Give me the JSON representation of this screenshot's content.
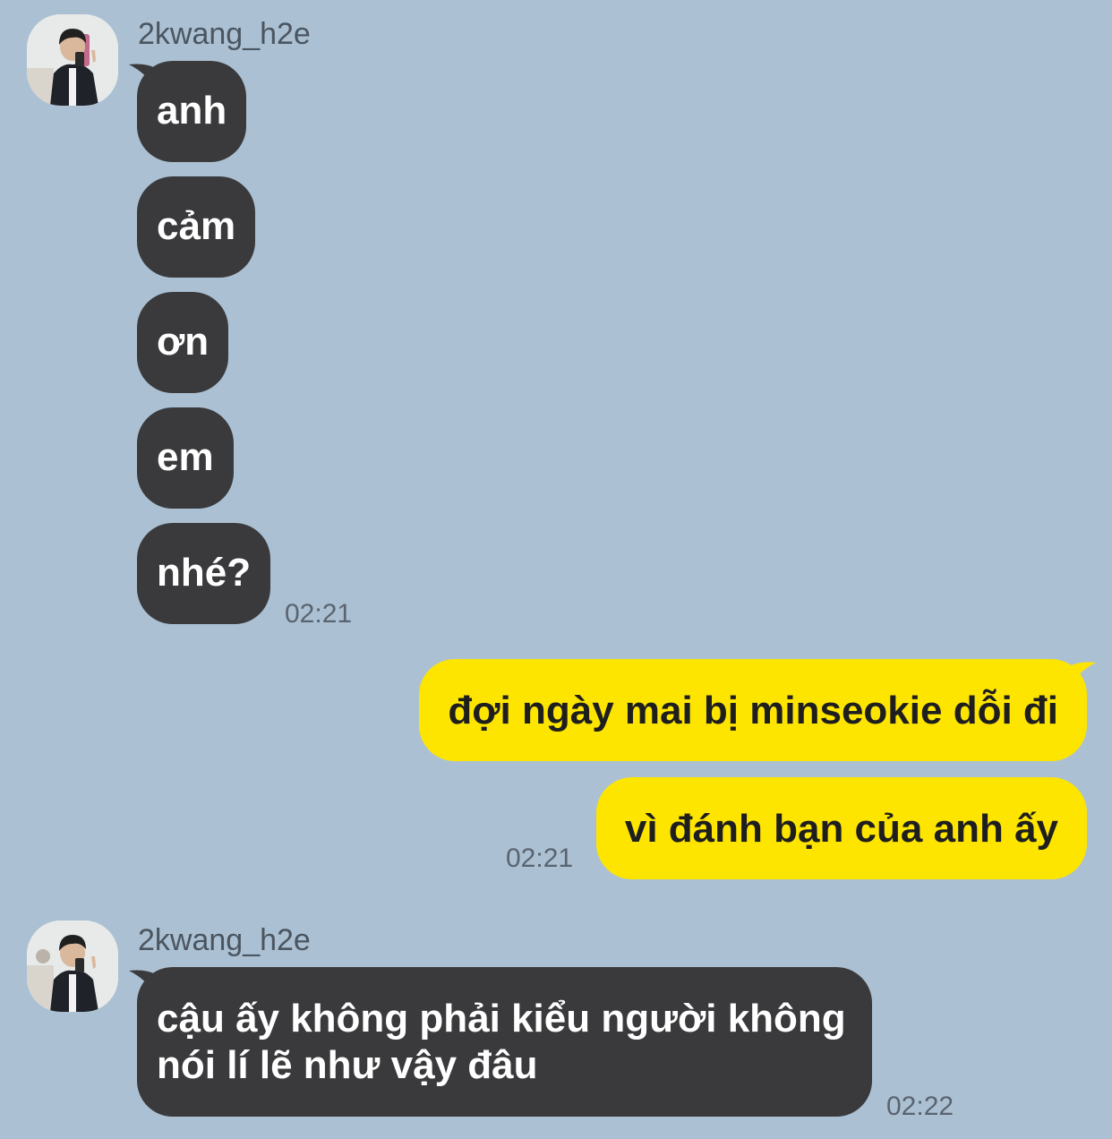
{
  "conversation": {
    "group1": {
      "sender": "2kwang_h2e",
      "messages": [
        "anh",
        "cảm",
        "ơn",
        "em",
        "nhé?"
      ],
      "time": "02:21"
    },
    "group2": {
      "messages": [
        "đợi ngày mai bị minseokie dỗi đi",
        "vì đánh bạn của anh ấy"
      ],
      "time": "02:21"
    },
    "group3": {
      "sender": "2kwang_h2e",
      "message_line1": "cậu ấy không phải kiểu người không",
      "message_line2": "nói lí lẽ như vậy đâu",
      "time": "02:22"
    }
  },
  "colors": {
    "background": "#abc1d3",
    "incoming_bubble": "#3a3a3d",
    "outgoing_bubble": "#fee500"
  },
  "icons": {
    "avatar": "profile-photo"
  }
}
